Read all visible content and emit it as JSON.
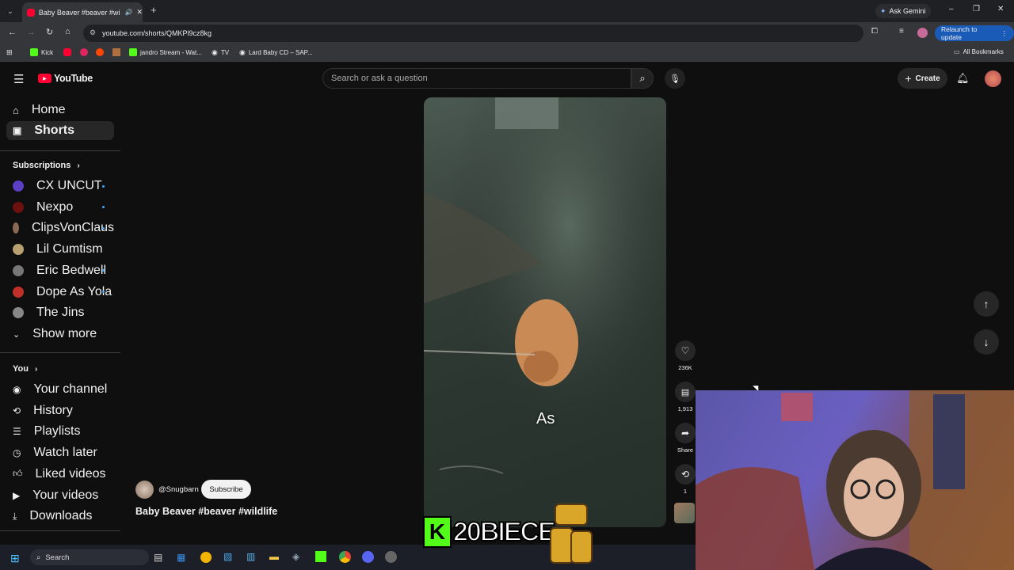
{
  "browser": {
    "tab_title": "Baby Beaver #beaver #wildl",
    "new_tab": "+",
    "ask_gemini": "Ask Gemini",
    "url": "youtube.com/shorts/QMKPl9cz8kg",
    "relaunch": "Relaunch to update",
    "bookmarks": [
      "Kick",
      "jandro Stream - Wat...",
      "TV",
      "Lard Baby CD – SAP..."
    ],
    "all_bookmarks": "All Bookmarks"
  },
  "youtube": {
    "logo": "YouTube",
    "search_placeholder": "Search or ask a question",
    "create": "Create",
    "sidebar": {
      "home": "Home",
      "shorts": "Shorts",
      "subscriptions": "Subscriptions",
      "channels": [
        {
          "name": "CX UNCUT",
          "color": "#5b3fc4"
        },
        {
          "name": "Nexpo",
          "color": "#6e1010"
        },
        {
          "name": "ClipsVonClaus",
          "color": "#8a6a55"
        },
        {
          "name": "Lil Cumtism",
          "color": "#b8a070"
        },
        {
          "name": "Eric Bedwell",
          "color": "#777777"
        },
        {
          "name": "Dope As Yola",
          "color": "#c0302a"
        },
        {
          "name": "The Jins",
          "color": "#888888"
        }
      ],
      "show_more": "Show more",
      "you": "You",
      "you_items": [
        "Your channel",
        "History",
        "Playlists",
        "Watch later",
        "Liked videos",
        "Your videos",
        "Downloads"
      ]
    },
    "short": {
      "caption": "As",
      "channel": "@Snugbarn",
      "subscribe": "Subscribe",
      "title": "Baby Beaver #beaver #wildlife",
      "likes": "236K",
      "comments": "1,913",
      "share": "Share",
      "remix": "1"
    }
  },
  "overlay": {
    "text": "20BIECE",
    "k_letter": "K"
  },
  "taskbar": {
    "search": "Search"
  }
}
